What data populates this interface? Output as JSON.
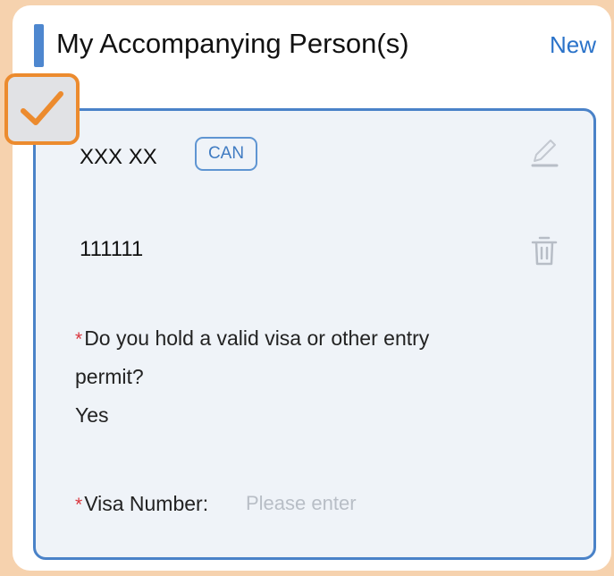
{
  "header": {
    "title": "My Accompanying Person(s)",
    "new_label": "New"
  },
  "person": {
    "name": "XXX XX",
    "country_code": "CAN",
    "id_number": "111111",
    "visa_question_line1": "Do you hold a valid visa or other entry",
    "visa_question_line2": "permit?",
    "visa_answer": "Yes",
    "visa_number_label": "Visa Number:",
    "visa_number_placeholder": "Please enter",
    "visa_number_value": "",
    "required_marker": "*"
  },
  "selection": {
    "checked": true
  },
  "icons": {
    "edit": "pencil-icon",
    "delete": "trash-icon",
    "checkbox": "checkmark-icon"
  },
  "colors": {
    "background": "#f6d2ae",
    "accent_blue": "#4a82c8",
    "link_blue": "#2b73c9",
    "checkbox_border": "#ec8b2e",
    "required_red": "#d9363e"
  }
}
